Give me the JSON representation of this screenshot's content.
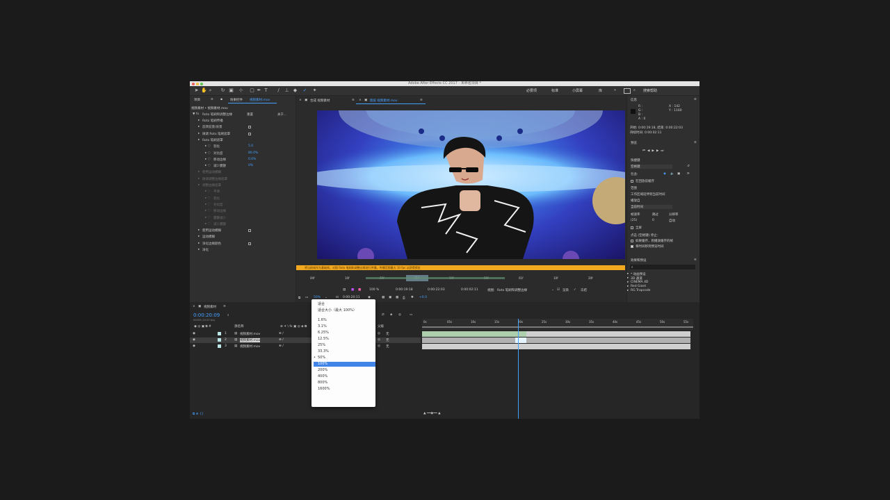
{
  "window": {
    "title": "Adobe After Effects CC 2017 - 未命名项目 *"
  },
  "workspaces": [
    "必要项",
    "标准",
    "小屏幕",
    "库"
  ],
  "search_help": "搜索帮助",
  "effects_panel": {
    "tab_label": "项目",
    "tab_title": "效果控件",
    "tab_file": "视频素材.mov",
    "breadcrumb": "视频素材 • 视频素材.mov",
    "effect_name": "Roto 笔刷和调整边缘",
    "reset_label": "重置",
    "about_label": "关于...",
    "rows": [
      {
        "label": "Roto 笔刷传播",
        "indent": 1,
        "dim": false
      },
      {
        "label": "反转前景/背景",
        "indent": 1,
        "dim": false,
        "check": true
      },
      {
        "label": "微调 Roto 笔刷遮罩",
        "indent": 1,
        "dim": false,
        "check": true
      },
      {
        "label": "Roto 笔刷遮罩",
        "indent": 1,
        "dim": false
      },
      {
        "label": "羽化",
        "indent": 2,
        "dim": false,
        "value": "5.0"
      },
      {
        "label": "对比度",
        "indent": 2,
        "dim": false,
        "value": "80.0%"
      },
      {
        "label": "移动边缘",
        "indent": 2,
        "dim": false,
        "value": "0.0%"
      },
      {
        "label": "减少震颤",
        "indent": 2,
        "dim": false,
        "value": "0%"
      },
      {
        "label": "使用运动模糊",
        "indent": 1,
        "dim": true
      },
      {
        "label": "微调调整边缘遮罩",
        "indent": 1,
        "dim": true
      },
      {
        "label": "调整边缘遮罩",
        "indent": 1,
        "dim": true
      },
      {
        "label": "平滑",
        "indent": 2,
        "dim": true
      },
      {
        "label": "羽化",
        "indent": 2,
        "dim": true
      },
      {
        "label": "对比度",
        "indent": 2,
        "dim": true
      },
      {
        "label": "移动边缘",
        "indent": 2,
        "dim": true
      },
      {
        "label": "震颤减少",
        "indent": 2,
        "dim": true
      },
      {
        "label": "减少震颤",
        "indent": 2,
        "dim": true
      },
      {
        "label": "使用运动模糊",
        "indent": 1,
        "dim": false,
        "check": true
      },
      {
        "label": "运动模糊",
        "indent": 1,
        "dim": false
      },
      {
        "label": "净化边缘颜色",
        "indent": 1,
        "dim": false,
        "check": true
      },
      {
        "label": "净化",
        "indent": 1,
        "dim": false
      }
    ]
  },
  "comp_tabs": {
    "comp_label": "合成 视频素材",
    "layer_label": "图层 视频素材.mov"
  },
  "warning_text": "将当前帧作为基础帧，对照 Roto 笔刷和调整边缘进行传播，传播范围最大 10 fps 以获得预览",
  "ruler_ticks": [
    "00f",
    "10f",
    "20f",
    "01f",
    "10f",
    "20f",
    "01f",
    "10f",
    "20f"
  ],
  "comp_controls": {
    "zoom": "100 %",
    "time_a": "0:00:19:18",
    "time_b": "0:00:22:03",
    "time_c": "0:00:02:11",
    "view_label": "视图:",
    "view_value": "Roto 笔刷和调整边缘",
    "render_label": "渲染",
    "freeze_label": "冻结",
    "magnify": "50%",
    "current_time": "0:00:20:11",
    "exposure": "+0.0"
  },
  "zoom_menu": {
    "items": [
      "适合",
      "适合大小（最大 100%）",
      "1.6%",
      "3.1%",
      "6.25%",
      "12.5%",
      "25%",
      "33.3%",
      "50%",
      "100%",
      "200%",
      "400%",
      "800%",
      "1600%"
    ],
    "selected": "100%",
    "checked": "50%"
  },
  "right_panel": {
    "info_title": "信息",
    "info_r": "R :",
    "info_g": "G :",
    "info_b": "B :",
    "info_a": "A : 0",
    "info_x": "X : 142",
    "info_y": "Y : 1160",
    "info_start": "开始: 0:00:19:18, 结束: 0:00:22:03",
    "info_dur": "持续时间: 0:00:02:11",
    "preview_title": "预览",
    "shortcut_title": "快捷键",
    "shortcut_value": "空格键",
    "include_label": "包含:",
    "cache_label": "在回放前缓存",
    "range_label": "范围",
    "range_value": "工作区域延伸到当前时间",
    "play_from": "播放自",
    "play_from_value": "当前时间",
    "fps_label": "帧速率",
    "fps_value": "(25)",
    "skip_label": "跳过",
    "skip_value": "0",
    "res_label": "分辨率",
    "res_value": "自动",
    "fullscreen": "全屏",
    "onstop": "点击 (空格键) 停止:",
    "cache_opt": "如果缓存，则播放缓存的帧",
    "move_opt": "将时间移到预览时间",
    "effects_title": "效果和预设",
    "effect_items": [
      "* 动画预设",
      "3D 通道",
      "CINEMA 4D",
      "Red Giant",
      "RG Trapcode"
    ]
  },
  "timeline": {
    "tab_label": "视频素材",
    "current_time": "0:00:20:09",
    "fps_info": "00509 (25.00 fps)",
    "col_name": "源名称",
    "col_parent": "父级",
    "layers": [
      {
        "num": "1",
        "name": "视频素材.mov",
        "parent": "无"
      },
      {
        "num": "2",
        "name": "视频素材.mov",
        "parent": "无"
      },
      {
        "num": "3",
        "name": "视频素材.mov",
        "parent": "无"
      }
    ],
    "ruler": [
      "0s",
      "05s",
      "10s",
      "15s",
      "20s",
      "25s",
      "30s",
      "35s",
      "40s",
      "45s",
      "50s",
      "55s"
    ]
  },
  "colors": {
    "accent": "#46a0ff",
    "warning": "#f2a81f",
    "menu_sel": "#3f84e6"
  }
}
